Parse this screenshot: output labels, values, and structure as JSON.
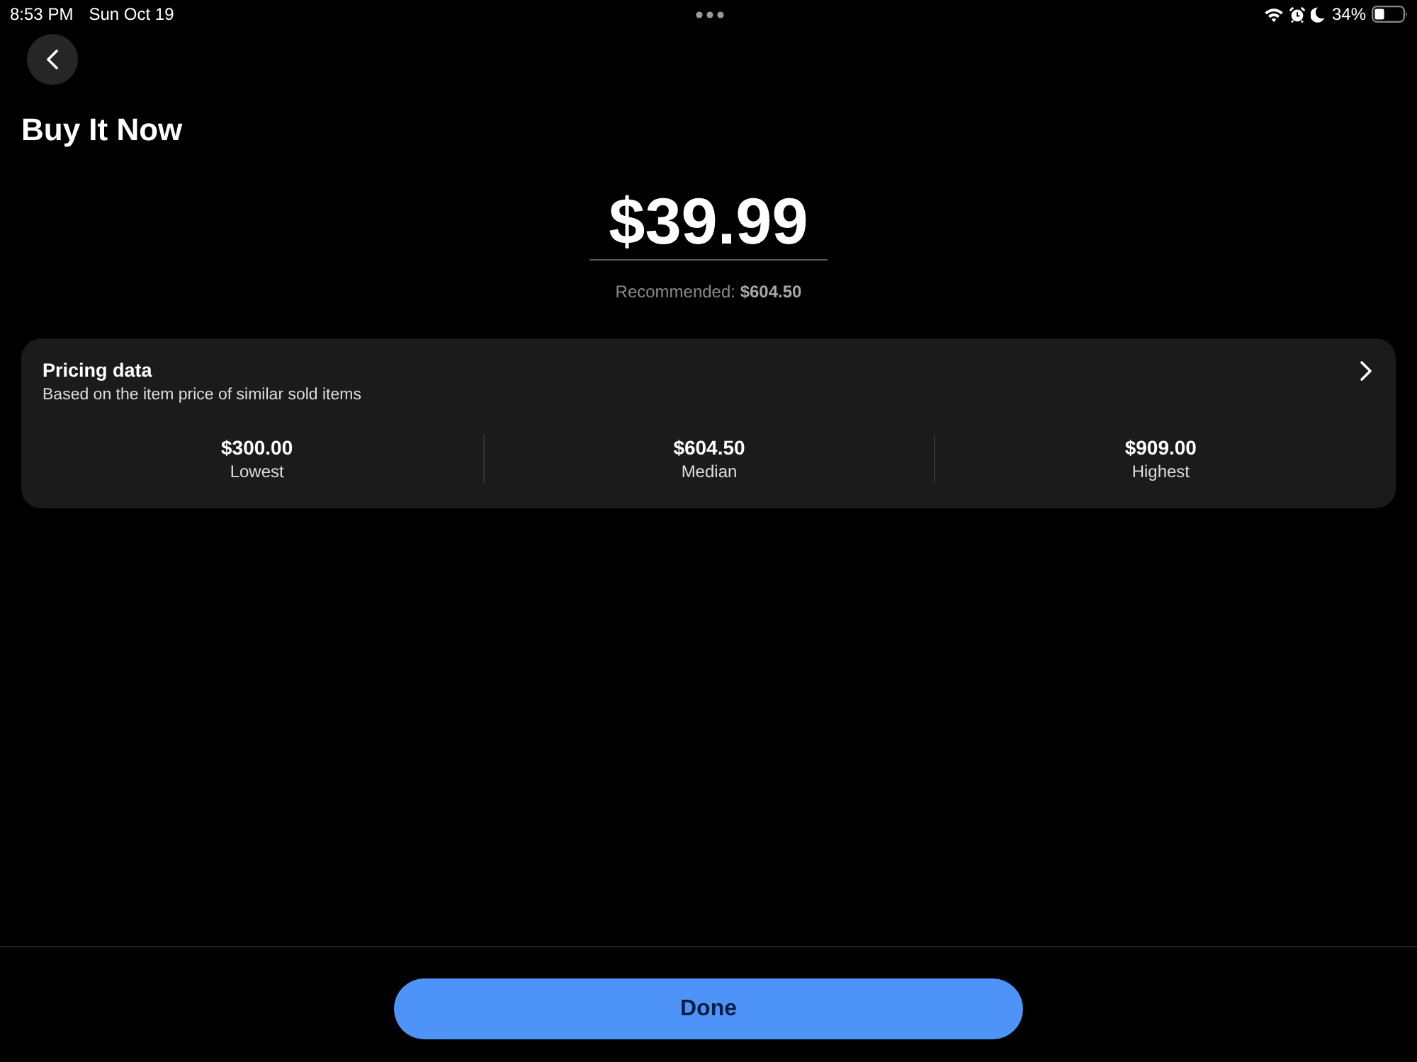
{
  "status_bar": {
    "time": "8:53 PM",
    "date": "Sun Oct 19",
    "battery": "34%"
  },
  "header": {
    "title": "Buy It Now"
  },
  "price": {
    "value": "$39.99",
    "recommended": "Recommended: **$604.50**"
  },
  "pricing_data": {
    "title": "Pricing data",
    "subtitle": "Based on the item price of similar sold items",
    "stats": [
      {
        "value": "$300.00",
        "label": "Lowest"
      },
      {
        "value": "$604.50",
        "label": "Median"
      },
      {
        "value": "$909.00",
        "label": "Highest"
      }
    ]
  },
  "footer": {
    "button": "Done"
  }
}
